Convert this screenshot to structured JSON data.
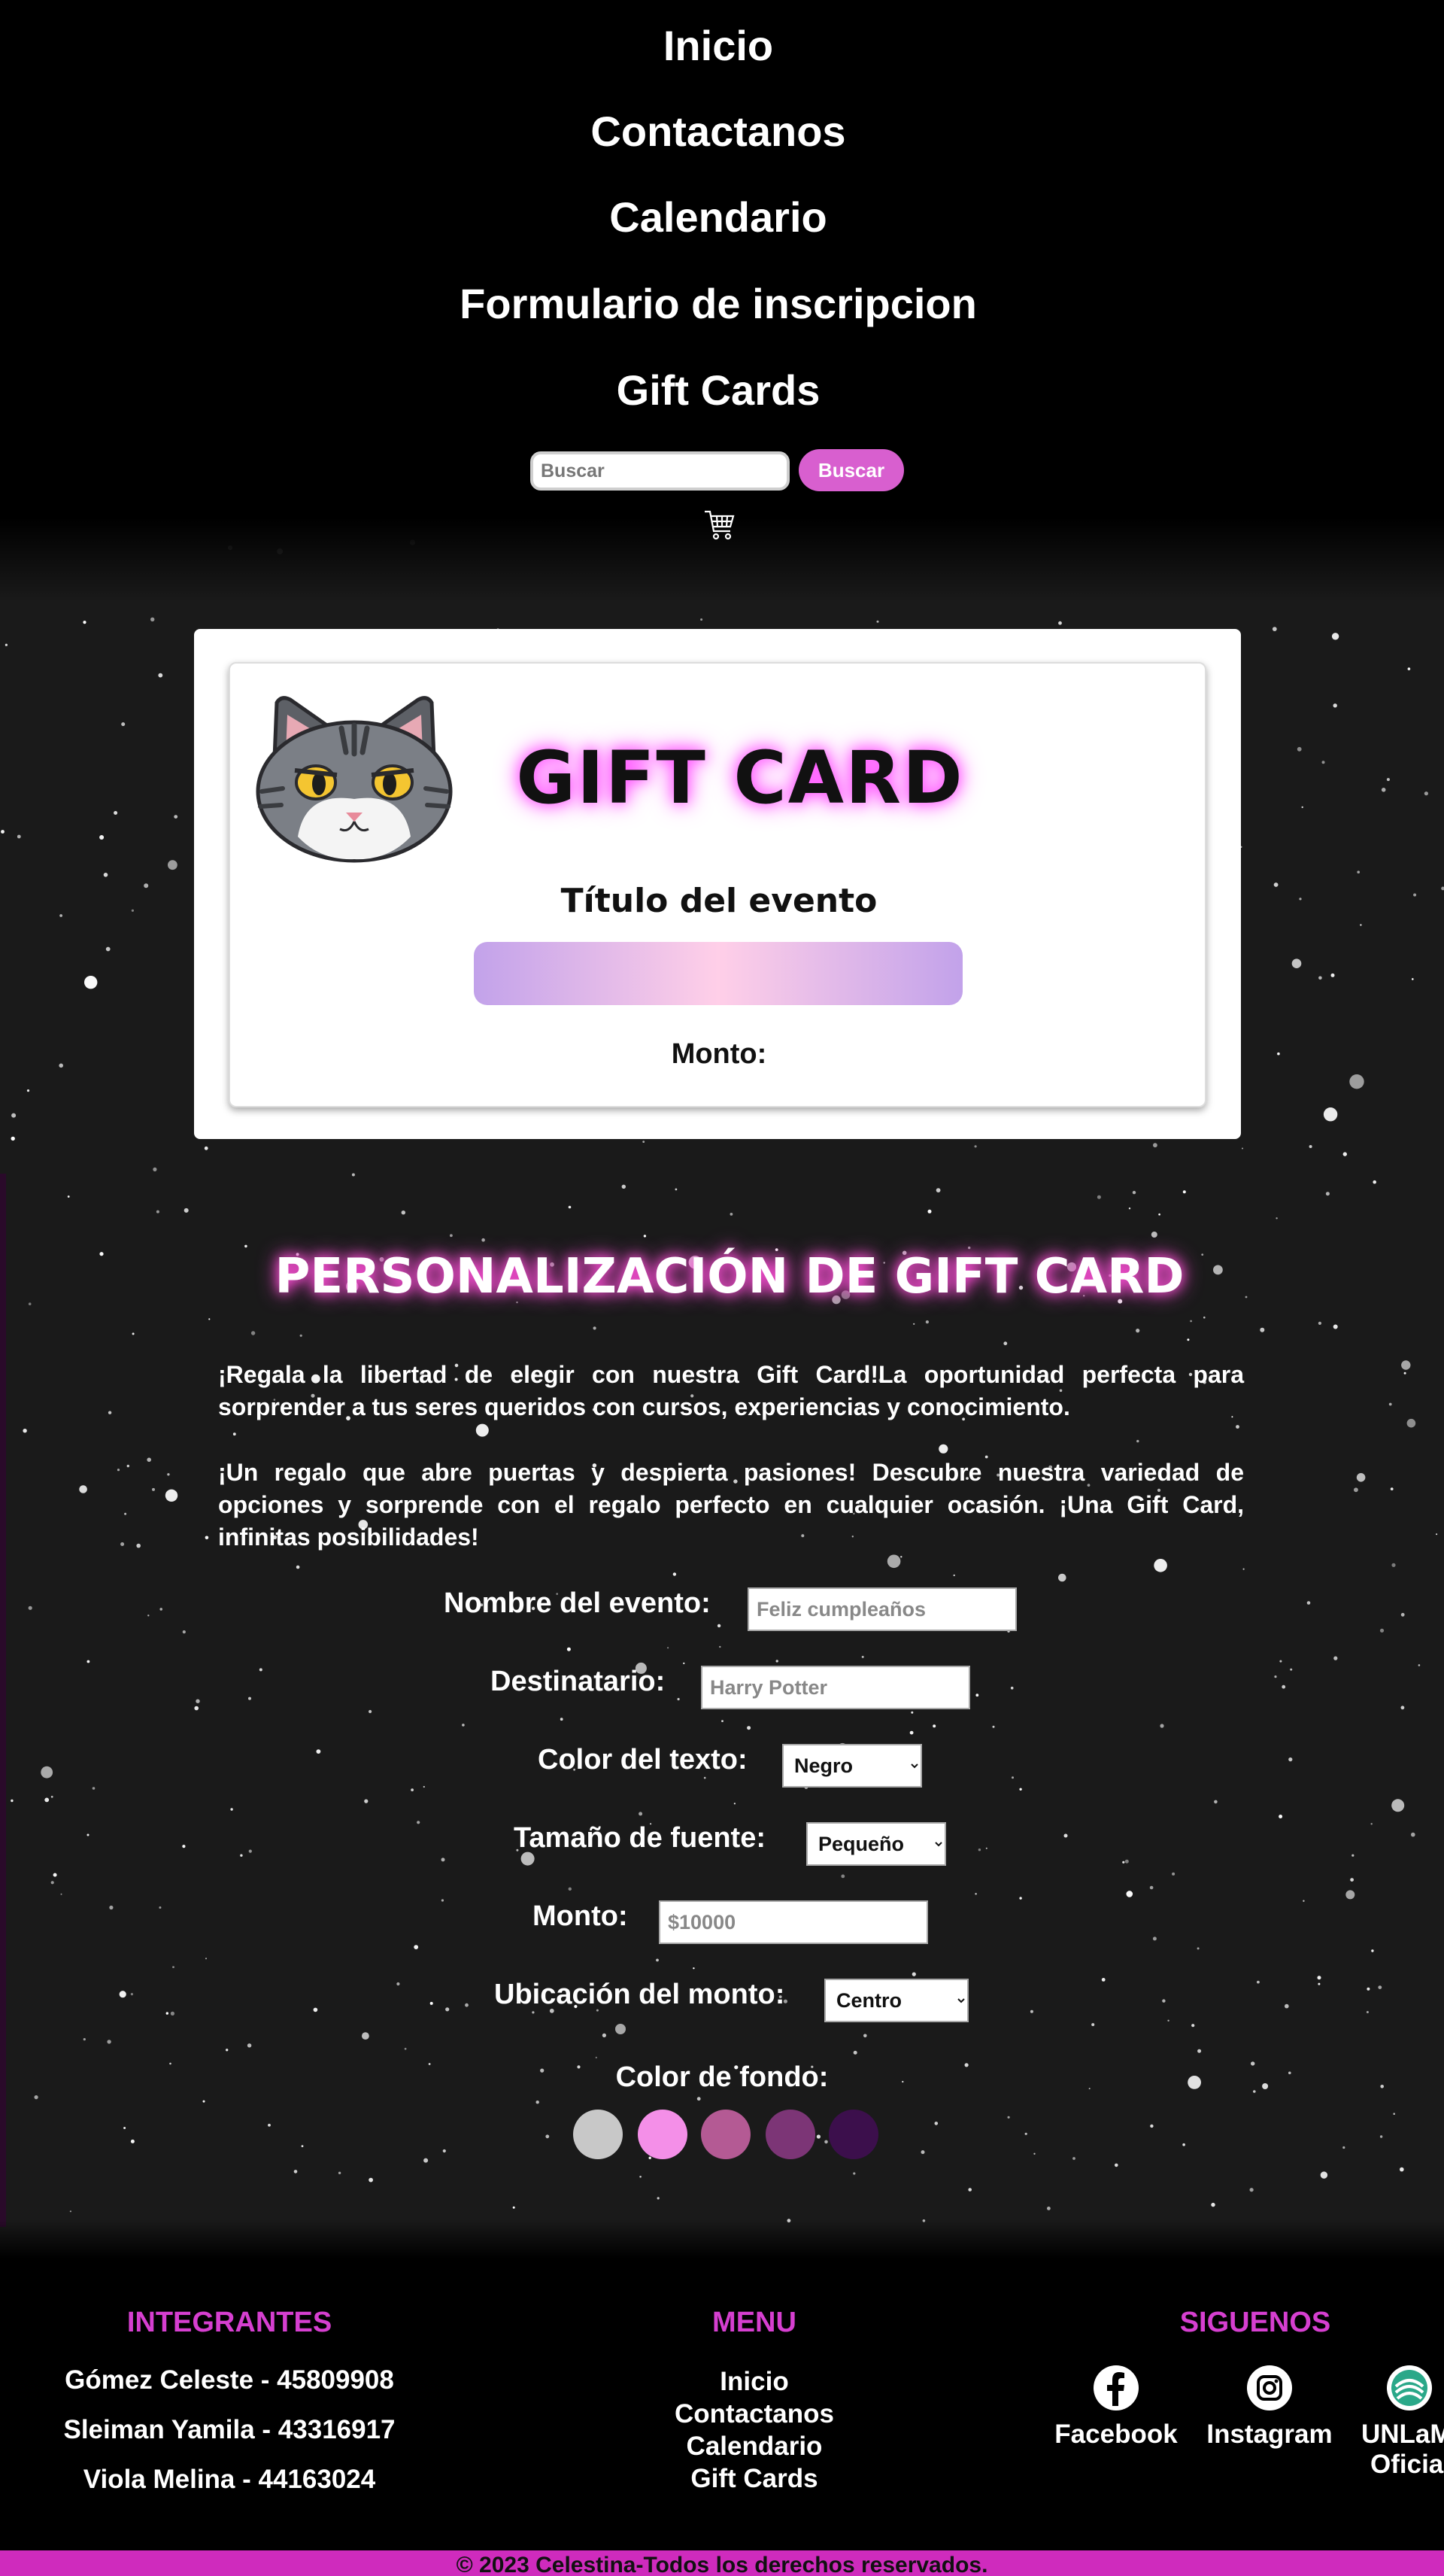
{
  "nav": {
    "items": [
      "Inicio",
      "Contactanos",
      "Calendario",
      "Formulario de inscripcion",
      "Gift Cards"
    ]
  },
  "search": {
    "placeholder": "Buscar",
    "button_label": "Buscar"
  },
  "cart": {
    "icon": "cart-icon"
  },
  "gift_card": {
    "heading": "GIFT CARD",
    "event_title": "Título del evento",
    "amount_label": "Monto:",
    "logo_icon": "cat-face-icon",
    "bar_gradient": [
      "#c2a2ea",
      "#ffcfe8",
      "#c2a2ea"
    ]
  },
  "personalization": {
    "heading": "PERSONALIZACIÓN DE GIFT CARD",
    "intro_1": "¡Regala la libertad de elegir con nuestra Gift Card!La oportunidad perfecta para sorprender a tus seres queridos con cursos, experiencias y conocimiento.",
    "intro_2": "¡Un regalo que abre puertas y despierta pasiones! Descubre nuestra variedad de opciones y sorprende con el regalo perfecto en cualquier ocasión. ¡Una Gift Card, infinitas posibilidades!",
    "fields": {
      "event_name": {
        "label": "Nombre del evento:",
        "placeholder": "Feliz cumpleaños"
      },
      "recipient": {
        "label": "Destinatario:",
        "placeholder": "Harry Potter"
      },
      "text_color": {
        "label": "Color del texto:",
        "value": "Negro"
      },
      "font_size": {
        "label": "Tamaño de fuente:",
        "value": "Pequeño"
      },
      "amount": {
        "label": "Monto:",
        "placeholder": "$10000"
      },
      "amount_position": {
        "label": "Ubicación del monto:",
        "value": "Centro"
      }
    },
    "bg_color_label": "Color de fondo:",
    "bg_colors": [
      "#c8c8c8",
      "#f48fe8",
      "#b45a94",
      "#7c3576",
      "#3c0f4c"
    ]
  },
  "footer": {
    "members_heading": "INTEGRANTES",
    "members": [
      "Gómez Celeste - 45809908",
      "Sleiman Yamila - 43316917",
      "Viola Melina - 44163024"
    ],
    "menu_heading": "MENU",
    "menu": [
      "Inicio",
      "Contactanos",
      "Calendario",
      "Gift Cards"
    ],
    "social_heading": "SIGUENOS",
    "social": [
      {
        "label": "Facebook",
        "icon": "facebook-icon"
      },
      {
        "label": "Instagram",
        "icon": "instagram-icon"
      },
      {
        "label_line1": "UNLaM",
        "label_line2": "Oficial",
        "icon": "unlam-icon"
      }
    ],
    "copyright": "© 2023 Celestina-Todos los derechos reservados."
  },
  "colors": {
    "accent_pink": "#d85fcf",
    "footer_heading": "#d63fd0",
    "copyright_bar": "#cf2bbd"
  }
}
